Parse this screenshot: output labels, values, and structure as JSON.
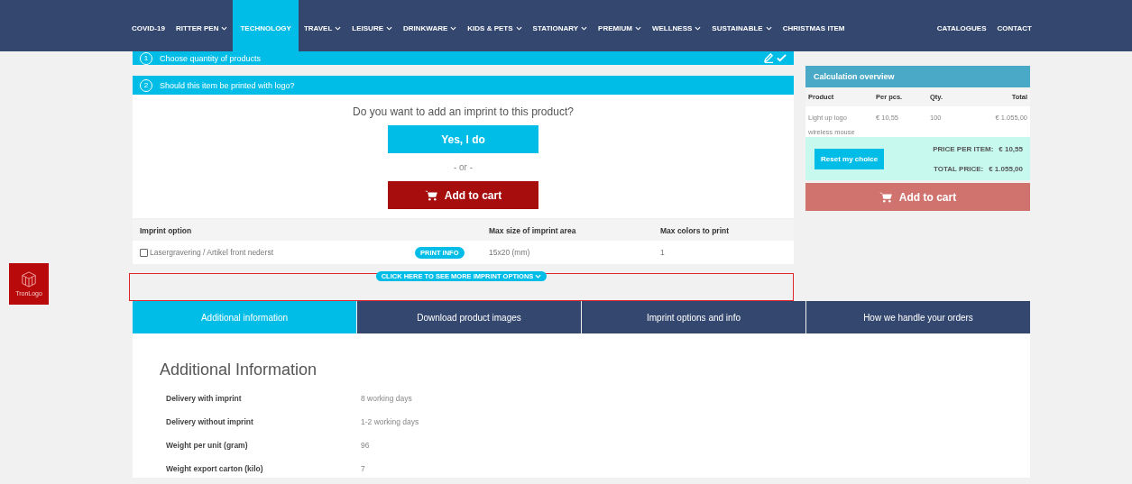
{
  "nav": {
    "items": [
      {
        "label": "COVID-19",
        "dropdown": false,
        "selected": false
      },
      {
        "label": "RITTER PEN",
        "dropdown": true,
        "selected": false
      },
      {
        "label": "TECHNOLOGY",
        "dropdown": false,
        "selected": true
      },
      {
        "label": "TRAVEL",
        "dropdown": true,
        "selected": false
      },
      {
        "label": "LEISURE",
        "dropdown": true,
        "selected": false
      },
      {
        "label": "DRINKWARE",
        "dropdown": true,
        "selected": false
      },
      {
        "label": "KIDS & PETS",
        "dropdown": true,
        "selected": false
      },
      {
        "label": "STATIONARY",
        "dropdown": true,
        "selected": false
      },
      {
        "label": "PREMIUM",
        "dropdown": true,
        "selected": false
      },
      {
        "label": "WELLNESS",
        "dropdown": true,
        "selected": false
      },
      {
        "label": "SUSTAINABLE",
        "dropdown": true,
        "selected": false
      },
      {
        "label": "CHRISTMAS ITEM",
        "dropdown": false,
        "selected": false
      }
    ],
    "right_items": [
      {
        "label": "CATALOGUES"
      },
      {
        "label": "CONTACT"
      }
    ]
  },
  "steps": [
    {
      "number": "1",
      "title": "Choose quantity of products",
      "done": true
    },
    {
      "number": "2",
      "title": "Should this item be printed with logo?",
      "done": false
    }
  ],
  "imprint": {
    "question": "Do you want to add an imprint to this product?",
    "yes_button": "Yes, I do",
    "or": "- or -",
    "cart_button": "Add to cart"
  },
  "imprint_table": {
    "columns": [
      "Imprint option",
      "Max size of imprint area",
      "Max colors to print"
    ],
    "rows": [
      {
        "option": "Lasergravering / Artikel front nederst",
        "checked": false,
        "info_button": "PRINT INFO",
        "size": "15x20 (mm)",
        "colors": "1"
      }
    ],
    "more_button": "CLICK HERE TO SEE MORE IMPRINT OPTIONS"
  },
  "calculation": {
    "title": "Calculation overview",
    "columns": [
      "Product",
      "Per pcs.",
      "Qty.",
      "Total"
    ],
    "rows": [
      {
        "product": "Light up logo wireless mouse",
        "per_pcs": "€ 10,55",
        "qty": "100",
        "total": "€ 1.055,00"
      }
    ],
    "reset_button": "Reset my choice",
    "price_per_item_label": "PRICE PER ITEM:",
    "price_per_item": "€ 10,55",
    "total_label": "TOTAL PRICE:",
    "total": "€ 1.055,00",
    "cart_button": "Add to cart"
  },
  "side_badge": {
    "label": "TronLogo"
  },
  "tabs": [
    {
      "label": "Additional information",
      "selected": true
    },
    {
      "label": "Download product images",
      "selected": false
    },
    {
      "label": "Imprint options and info",
      "selected": false
    },
    {
      "label": "How we handle your orders",
      "selected": false
    }
  ],
  "info": {
    "heading": "Additional Information",
    "rows": [
      {
        "label": "Delivery with imprint",
        "value": "8 working days"
      },
      {
        "label": "Delivery without imprint",
        "value": "1-2 working days"
      },
      {
        "label": "Weight per unit (gram)",
        "value": "96"
      },
      {
        "label": "Weight export carton (kilo)",
        "value": "7"
      }
    ]
  }
}
